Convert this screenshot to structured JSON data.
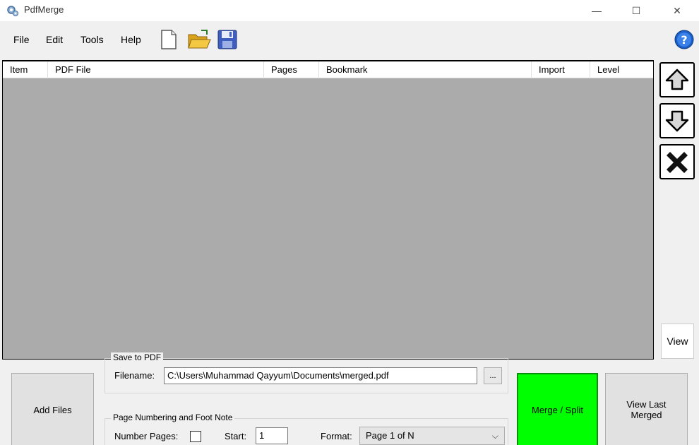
{
  "window": {
    "title": "PdfMerge",
    "minimize_glyph": "—",
    "maximize_glyph": "☐",
    "close_glyph": "✕"
  },
  "menu": [
    "File",
    "Edit",
    "Tools",
    "Help"
  ],
  "toolbar": {
    "icons": [
      "new-file-icon",
      "open-folder-icon",
      "save-disk-icon"
    ],
    "help_icon": "help-question-icon"
  },
  "table": {
    "columns": [
      "Item",
      "PDF File",
      "Pages",
      "Bookmark",
      "Import",
      "Level"
    ],
    "rows": []
  },
  "side_buttons": {
    "up_icon": "arrow-up-icon",
    "down_icon": "arrow-down-icon",
    "delete_icon": "delete-x-icon",
    "view_label": "View"
  },
  "bottom": {
    "add_files_label": "Add Files",
    "save_group_title": "Save to PDF",
    "filename_label": "Filename:",
    "filename_value": "C:\\Users\\Muhammad Qayyum\\Documents\\merged.pdf",
    "browse_label": "...",
    "numbering_group_title": "Page Numbering and Foot Note",
    "number_pages_label": "Number Pages:",
    "number_pages_checked": false,
    "start_label": "Start:",
    "start_value": "1",
    "format_label": "Format:",
    "format_value": "Page 1 of N",
    "merge_split_label": "Merge / Split",
    "view_last_label": "View Last Merged"
  },
  "colors": {
    "merge_button": "#00ff00",
    "grid_background": "#ababab",
    "help_icon": "#1a5fc8"
  }
}
